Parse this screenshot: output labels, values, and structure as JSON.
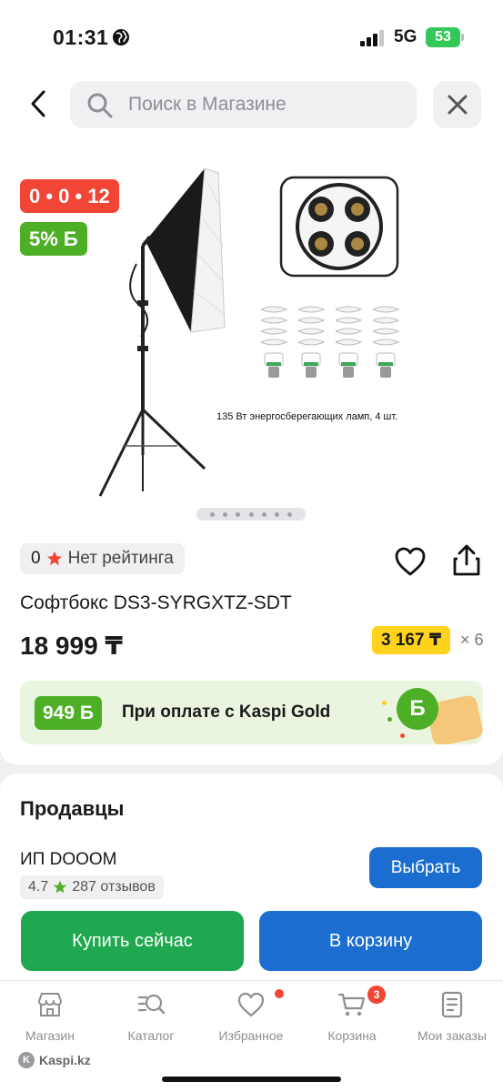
{
  "status_bar": {
    "time": "01:31",
    "network": "5G",
    "battery": "53"
  },
  "search": {
    "placeholder": "Поиск в Магазине"
  },
  "product": {
    "badge_timer": "0 • 0 • 12",
    "badge_bonus": "5% Б",
    "image_caption": "135 Вт энергосберегающих ламп, 4 шт.",
    "image_count": 7,
    "rating_count": "0",
    "rating_text": "Нет рейтинга",
    "title": "Софтбокс DS3-SYRGXTZ-SDT",
    "price": "18 999 ₸",
    "installment": "3 167 ₸",
    "installment_multiplier": "× 6"
  },
  "gold_banner": {
    "bonus": "949 Б",
    "text": "При оплате с Kaspi Gold",
    "coin": "Б"
  },
  "sellers": {
    "title": "Продавцы",
    "seller_name": "ИП DOOOM",
    "seller_rating": "4.7",
    "seller_reviews": "287 отзывов",
    "select_label": "Выбрать",
    "buy_now_label": "Купить сейчас",
    "cart_label": "В корзину"
  },
  "nav": {
    "items": [
      {
        "label": "Магазин",
        "icon": "store-icon"
      },
      {
        "label": "Каталог",
        "icon": "catalog-search-icon"
      },
      {
        "label": "Избранное",
        "icon": "heart-icon"
      },
      {
        "label": "Корзина",
        "icon": "cart-icon",
        "badge": "3"
      },
      {
        "label": "Мои заказы",
        "icon": "orders-icon"
      }
    ]
  },
  "footer": {
    "brand": "Kaspi.kz"
  },
  "colors": {
    "blue": "#1b6ed0",
    "green": "#1fa84f",
    "red": "#f14635",
    "yellow": "#ffd21e",
    "bonus_green": "#4caf26"
  }
}
